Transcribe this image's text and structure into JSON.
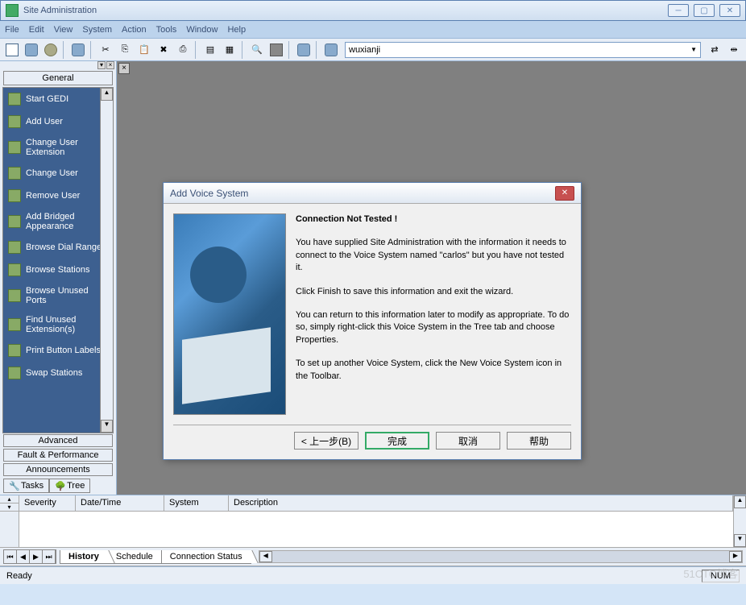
{
  "window": {
    "title": "Site Administration"
  },
  "menu": {
    "file": "File",
    "edit": "Edit",
    "view": "View",
    "system": "System",
    "action": "Action",
    "tools": "Tools",
    "window": "Window",
    "help": "Help"
  },
  "toolbar": {
    "combo_value": "wuxianji"
  },
  "sidebar": {
    "header": "General",
    "items": [
      "Start GEDI",
      "Add User",
      "Change User Extension",
      "Change User",
      "Remove User",
      "Add Bridged Appearance",
      "Browse Dial Ranges",
      "Browse Stations",
      "Browse Unused Ports",
      "Find Unused Extension(s)",
      "Print Button Labels",
      "Swap Stations"
    ],
    "cats": [
      "Advanced",
      "Fault & Performance",
      "Announcements"
    ],
    "tabs": {
      "tasks": "Tasks",
      "tree": "Tree"
    }
  },
  "dialog": {
    "title": "Add Voice System",
    "heading": "Connection Not Tested !",
    "p1": "You have supplied Site Administration with the information it needs to connect to the Voice System named \"carlos\" but you have not tested it.",
    "p2": "Click Finish to save this information and exit the wizard.",
    "p3": "You can return to this information later to modify as appropriate.  To do so, simply right-click this Voice System in the Tree tab and choose Properties.",
    "p4": "To set up another Voice System, click the New Voice System icon in the Toolbar.",
    "buttons": {
      "back": "< 上一步(B)",
      "finish": "完成",
      "cancel": "取消",
      "help": "帮助"
    }
  },
  "grid": {
    "cols": {
      "severity": "Severity",
      "datetime": "Date/Time",
      "system": "System",
      "description": "Description"
    }
  },
  "bottom_tabs": {
    "history": "History",
    "schedule": "Schedule",
    "connstatus": "Connection Status"
  },
  "status": {
    "ready": "Ready",
    "num": "NUM"
  },
  "watermark": "51CTO博客"
}
